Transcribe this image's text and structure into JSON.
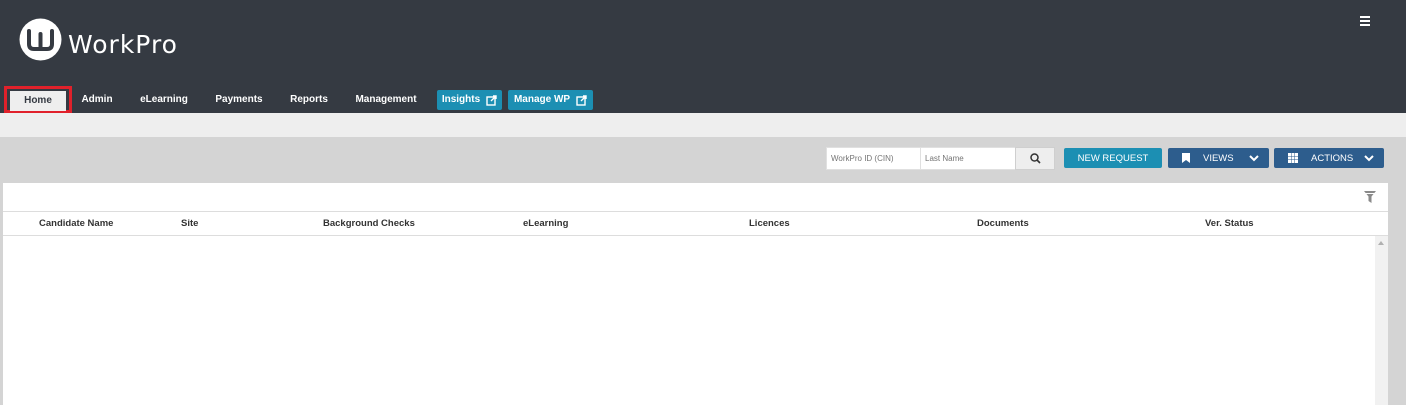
{
  "header": {
    "brand": "WorkPro",
    "menu_icon": "hamburger-menu-icon"
  },
  "nav": {
    "items": [
      {
        "label": "Home",
        "active": true
      },
      {
        "label": "Admin"
      },
      {
        "label": "eLearning"
      },
      {
        "label": "Payments"
      },
      {
        "label": "Reports"
      },
      {
        "label": "Management"
      },
      {
        "label": "Insights",
        "external": true
      },
      {
        "label": "Manage WP",
        "external": true
      }
    ]
  },
  "toolbar": {
    "cin_placeholder": "WorkPro ID (CIN)",
    "lastname_placeholder": "Last Name",
    "new_request_label": "NEW REQUEST",
    "views_label": "VIEWS",
    "actions_label": "ACTIONS"
  },
  "table": {
    "columns": [
      "Candidate Name",
      "Site",
      "Background Checks",
      "eLearning",
      "Licences",
      "Documents",
      "Ver. Status"
    ],
    "rows": []
  },
  "colors": {
    "header_bg": "#353a42",
    "accent_teal": "#1c8fb3",
    "accent_navy": "#2d5d8d",
    "highlight_red": "#e0212b"
  }
}
